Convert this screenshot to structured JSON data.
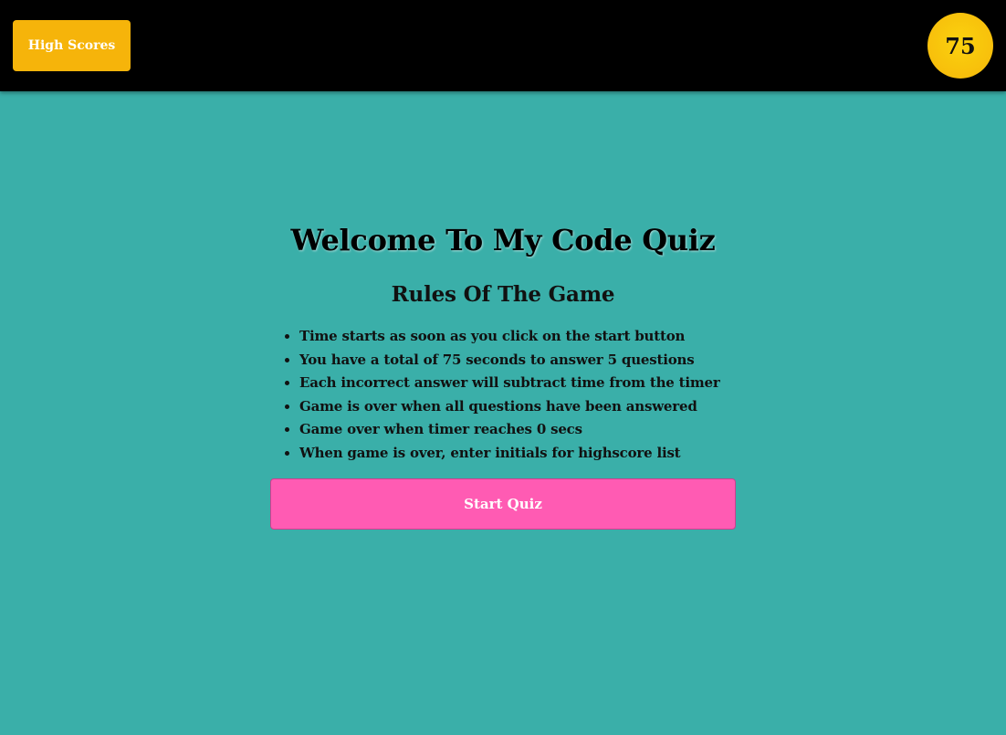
{
  "header": {
    "high_scores_label": "High Scores",
    "timer_value": "75"
  },
  "main": {
    "title": "Welcome To My Code Quiz",
    "subtitle": "Rules Of The Game",
    "rules": [
      "Time starts as soon as you click on the start button",
      "You have a total of 75 seconds to answer 5 questions",
      "Each incorrect answer will subtract time from the timer",
      "Game is over when all questions have been answered",
      "Game over when timer reaches 0 secs",
      "When game is over, enter initials for highscore list"
    ],
    "start_label": "Start Quiz"
  },
  "colors": {
    "background": "#3aafa9",
    "header_bar": "#000000",
    "high_scores_button": "#f6b40a",
    "timer_badge": "#f7bf0b",
    "start_button": "#ff5bb3"
  }
}
